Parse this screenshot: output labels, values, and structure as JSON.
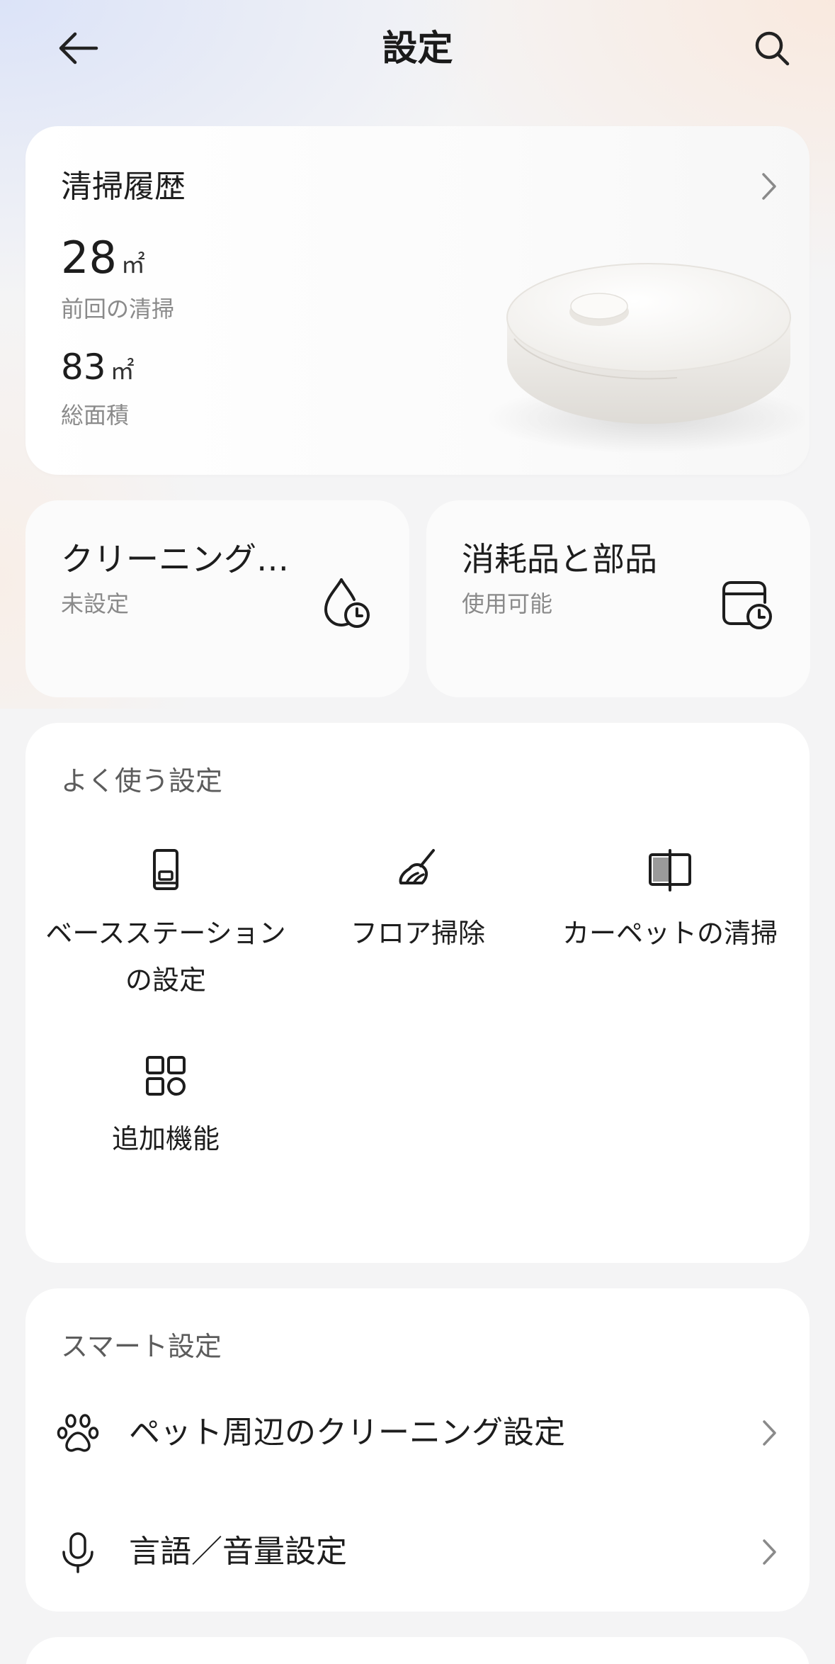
{
  "header": {
    "title": "設定",
    "back_icon": "arrow-left-icon",
    "search_icon": "search-icon"
  },
  "history": {
    "title": "清掃履歴",
    "last_value": "28",
    "last_unit": "㎡",
    "last_label": "前回の清掃",
    "total_value": "83",
    "total_unit": "㎡",
    "total_label": "総面積"
  },
  "quick_cards": [
    {
      "title": "クリーニング…",
      "subtitle": "未設定",
      "icon": "water-drop-clock-icon"
    },
    {
      "title": "消耗品と部品",
      "subtitle": "使用可能",
      "icon": "container-clock-icon"
    }
  ],
  "frequent": {
    "label": "よく使う設定",
    "items": [
      {
        "label": "ベースステーションの設定",
        "icon": "base-station-icon"
      },
      {
        "label": "フロア掃除",
        "icon": "mop-icon"
      },
      {
        "label": "カーペットの清掃",
        "icon": "carpet-icon"
      },
      {
        "label": "追加機能",
        "icon": "apps-grid-icon"
      }
    ]
  },
  "smart": {
    "label": "スマート設定",
    "items": [
      {
        "label": "ペット周辺のクリーニング設定",
        "icon": "paw-icon"
      },
      {
        "label": "言語／音量設定",
        "icon": "microphone-icon"
      }
    ]
  },
  "colors": {
    "background": "#f4f4f5",
    "card": "#ffffff",
    "text_primary": "#1d1d1d",
    "text_secondary": "#8a8a8a"
  }
}
